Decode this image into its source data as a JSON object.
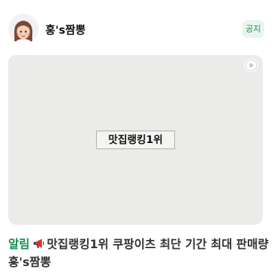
{
  "post": {
    "author_name": "홍's짬뽕",
    "badge_label": "공지",
    "media_caption": "맛집랭킹1위",
    "title_tag": "알림",
    "title_text": "맛집랭킹1위 쿠팡이츠 최단 기간 최대 판매량 홍's짬뽕"
  },
  "icons": {
    "avatar": "avatar-illustration",
    "media_indicator": "play-icon",
    "title_prefix": "megaphone-icon"
  },
  "colors": {
    "accent_green": "#15914b",
    "badge_background": "#eaf4ee",
    "media_background": "#ebebe9"
  }
}
